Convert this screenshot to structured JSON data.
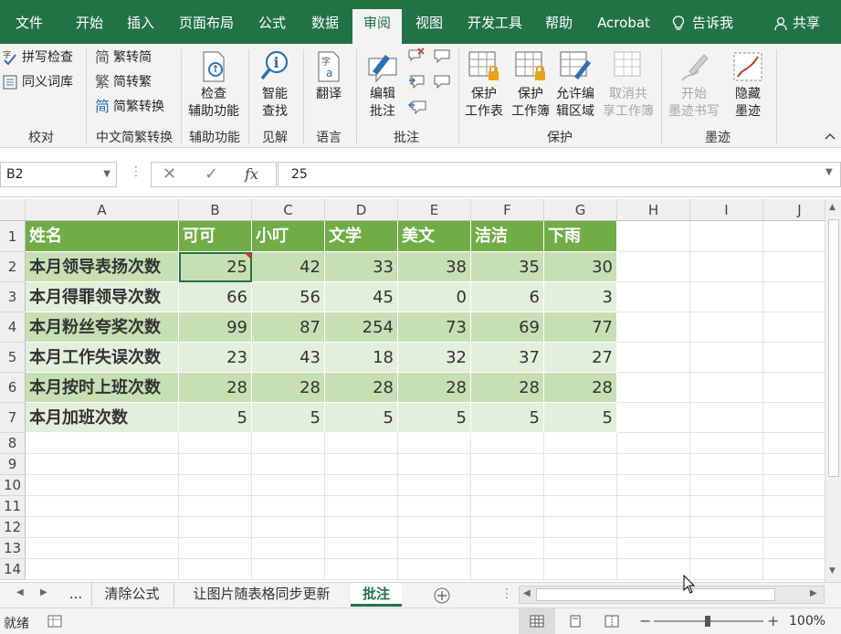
{
  "tabs": [
    "文件",
    "开始",
    "插入",
    "页面布局",
    "公式",
    "数据",
    "审阅",
    "视图",
    "开发工具",
    "帮助",
    "Acrobat"
  ],
  "active_tab": "审阅",
  "tell_me": "告诉我",
  "share": "共享",
  "ribbon": {
    "proofing": {
      "spell": "拼写检查",
      "thesaurus": "同义词库",
      "label": "校对"
    },
    "chinese": {
      "to_trad": "繁转简",
      "to_simp": "简转繁",
      "convert": "简繁转换",
      "label": "中文简繁转换"
    },
    "access": {
      "line1": "检查",
      "line2": "辅助功能",
      "label": "辅助功能"
    },
    "insights": {
      "line1": "智能",
      "line2": "查找",
      "label": "见解"
    },
    "language": {
      "translate": "翻译",
      "label": "语言"
    },
    "comments": {
      "line1": "编辑",
      "line2": "批注",
      "label": "批注"
    },
    "protect": {
      "sheet1": "保护",
      "sheet2": "工作表",
      "wb1": "保护",
      "wb2": "工作簿",
      "range1": "允许编",
      "range2": "辑区域",
      "unshare1": "取消共",
      "unshare2": "享工作簿",
      "label": "保护"
    },
    "ink": {
      "start1": "开始",
      "start2": "墨迹书写",
      "hide1": "隐藏",
      "hide2": "墨迹",
      "label": "墨迹"
    }
  },
  "name_box": "B2",
  "formula_value": "25",
  "columns": [
    "A",
    "B",
    "C",
    "D",
    "E",
    "F",
    "G",
    "H",
    "I",
    "J"
  ],
  "rows": [
    "1",
    "2",
    "3",
    "4",
    "5",
    "6",
    "7",
    "8",
    "9",
    "10",
    "11",
    "12",
    "13",
    "14"
  ],
  "table": {
    "headers": [
      "姓名",
      "可可",
      "小叮",
      "文学",
      "美文",
      "洁洁",
      "下雨"
    ],
    "data": [
      [
        "本月领导表扬次数",
        "25",
        "42",
        "33",
        "38",
        "35",
        "30"
      ],
      [
        "本月得罪领导次数",
        "66",
        "56",
        "45",
        "0",
        "6",
        "3"
      ],
      [
        "本月粉丝夸奖次数",
        "99",
        "87",
        "254",
        "73",
        "69",
        "77"
      ],
      [
        "本月工作失误次数",
        "23",
        "43",
        "18",
        "32",
        "37",
        "27"
      ],
      [
        "本月按时上班次数",
        "28",
        "28",
        "28",
        "28",
        "28",
        "28"
      ],
      [
        "本月加班次数",
        "5",
        "5",
        "5",
        "5",
        "5",
        "5"
      ]
    ]
  },
  "sheet_tabs": [
    "清除公式",
    "让图片随表格同步更新",
    "批注"
  ],
  "active_sheet": "批注",
  "more_sheets": "...",
  "status": {
    "mode": "就绪",
    "zoom": "100%"
  },
  "colors": {
    "ribbon": "#217346",
    "table_header": "#70ad47",
    "band1": "#c6e0b4",
    "band2": "#e2efda"
  }
}
